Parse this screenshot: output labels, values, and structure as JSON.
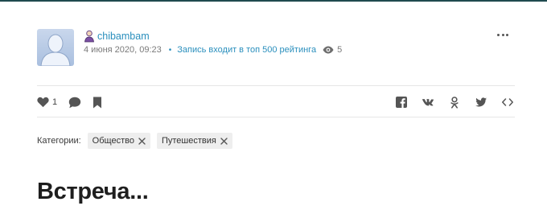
{
  "post": {
    "author": "chibambam",
    "date": "4 июня 2020, 09:23",
    "rating_note": "Запись входит в топ 500 рейтинга",
    "views": "5",
    "likes": "1",
    "title": "Встреча..."
  },
  "categories": {
    "label": "Категории:",
    "items": [
      {
        "label": "Общество"
      },
      {
        "label": "Путешествия"
      }
    ]
  },
  "icons": {
    "avatar": "default-avatar",
    "author": "user-icon",
    "views": "eye-icon",
    "more": "more-dots-icon",
    "like": "heart-icon",
    "comment": "comment-icon",
    "bookmark": "bookmark-icon",
    "share": [
      "facebook-icon",
      "vk-icon",
      "odnoklassniki-icon",
      "twitter-icon",
      "embed-icon"
    ]
  },
  "colors": {
    "link": "#2a8fbd",
    "top_rule": "#1f4a4f",
    "tag_bg": "#eeeeee",
    "icon": "#555555"
  }
}
